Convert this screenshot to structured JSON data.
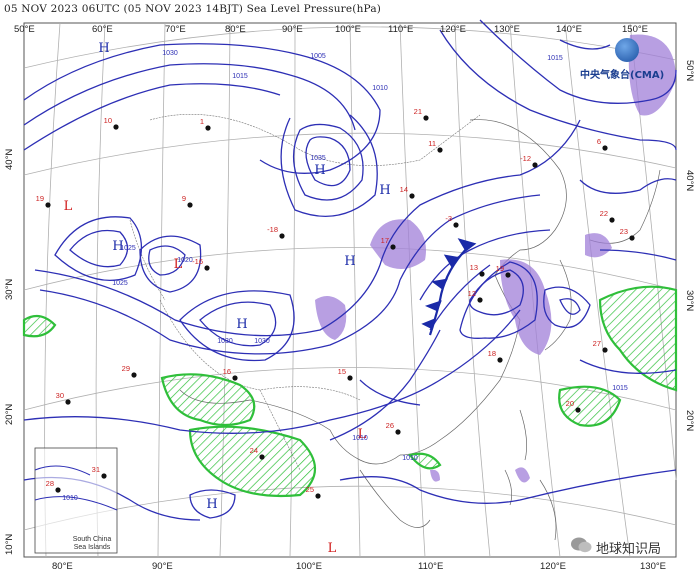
{
  "title": "05 NOV 2023 06UTC (05 NOV 2023 14BJT) Sea Level Pressure(hPa)",
  "logo": {
    "text": "中央气象台(CMA)",
    "icon": "cma-seal-icon"
  },
  "watermark": {
    "text": "地球知识局",
    "icon": "wechat-icon"
  },
  "inset": {
    "label_line1": "South China",
    "label_line2": "Sea Islands"
  },
  "axes": {
    "top_lon": [
      "50°E",
      "60°E",
      "70°E",
      "80°E",
      "90°E",
      "100°E",
      "110°E",
      "120°E",
      "130°E",
      "140°E",
      "150°E"
    ],
    "bottom_lon": [
      "80°E",
      "90°E",
      "100°E",
      "110°E",
      "120°E",
      "130°E"
    ],
    "left_lat": [
      "40°N",
      "30°N",
      "20°N",
      "10°N"
    ],
    "right_lat": [
      "50°N",
      "40°N",
      "30°N",
      "20°N"
    ]
  },
  "pressure_centers": [
    {
      "type": "H",
      "label": "H"
    },
    {
      "type": "H",
      "label": "H"
    },
    {
      "type": "H",
      "label": "H"
    },
    {
      "type": "H",
      "label": "H"
    },
    {
      "type": "H",
      "label": "H"
    },
    {
      "type": "H",
      "label": "H"
    },
    {
      "type": "L",
      "label": "L"
    },
    {
      "type": "L",
      "label": "L"
    },
    {
      "type": "L",
      "label": "L"
    },
    {
      "type": "L",
      "label": "L"
    },
    {
      "type": "H",
      "label": "H"
    }
  ],
  "isobar_labels": [
    "1030",
    "1015",
    "1005",
    "1010",
    "1035",
    "1025",
    "1020",
    "1030",
    "1025",
    "1030",
    "1010",
    "1015",
    "1010",
    "1015",
    "1010"
  ],
  "station_values": [
    "21",
    "1",
    "9",
    "19",
    "-16",
    "-3",
    "-18",
    "17",
    "24",
    "28",
    "31",
    "30",
    "25",
    "22",
    "19",
    "20",
    "13",
    "14",
    "-12",
    "6",
    "10",
    "23",
    "26",
    "27",
    "15",
    "16",
    "12",
    "29",
    "18",
    "11"
  ],
  "colors": {
    "isobar": "#2d2fb5",
    "precip_green": "#2fbf3a",
    "precip_purple": "#a07fd8",
    "high_label": "#1a2aa8",
    "low_label": "#d01a1a",
    "station_red": "#cc2222",
    "station_blue": "#1a2aa8",
    "coast": "#555555",
    "grid": "#a8a8a8"
  }
}
